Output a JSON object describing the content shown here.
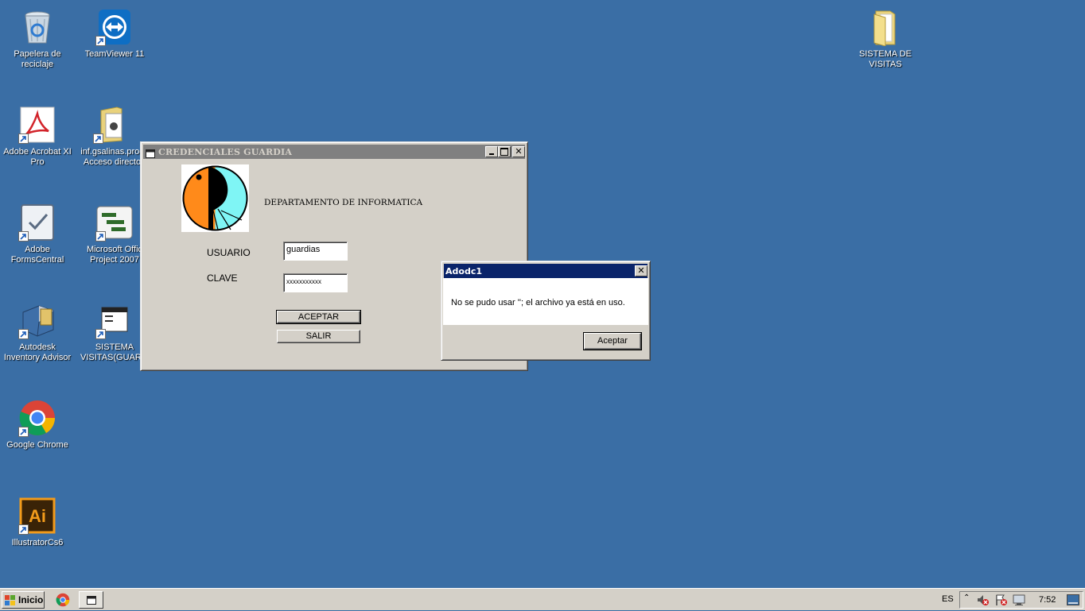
{
  "desktop": {
    "icons": [
      {
        "label": "Papelera de\nreciclaje",
        "icon": "recycle-bin-icon"
      },
      {
        "label": "TeamViewer 11",
        "icon": "teamviewer-icon"
      },
      {
        "label": "SISTEMA DE\nVISITAS",
        "icon": "folder-icon"
      },
      {
        "label": "Adobe Acrobat XI\nPro",
        "icon": "acrobat-icon"
      },
      {
        "label": "inf.gsalinas.proc\nAcceso directo",
        "icon": "folder-shortcut-icon"
      },
      {
        "label": "Adobe\nFormsCentral",
        "icon": "formscentral-icon"
      },
      {
        "label": "Microsoft Offic\nProject 2007",
        "icon": "ms-project-icon"
      },
      {
        "label": "Autodesk\nInventory Advisor",
        "icon": "autodesk-icon"
      },
      {
        "label": "SISTEMA\nVISITAS(GUAR...",
        "icon": "app-window-icon"
      },
      {
        "label": "Google Chrome",
        "icon": "chrome-icon"
      },
      {
        "label": "IllustratorCs6",
        "icon": "illustrator-icon"
      }
    ]
  },
  "login_window": {
    "title": "CREDENCIALES GUARDIA",
    "department": "DEPARTAMENTO DE INFORMATICA",
    "usuario_label": "USUARIO",
    "usuario_value": "guardias",
    "clave_label": "CLAVE",
    "clave_value": "xxxxxxxxxxx",
    "aceptar_label": "ACEPTAR",
    "salir_label": "SALIR"
  },
  "alert": {
    "title": "Adodc1",
    "message": "No se pudo usar ''; el archivo ya está en uso.",
    "ok_label": "Aceptar"
  },
  "taskbar": {
    "start_label": "Inicio",
    "language": "ES",
    "clock": "7:52"
  },
  "colors": {
    "desktop": "#3a6ea5",
    "inactive_title": "#808080",
    "active_title": "#0a246a"
  }
}
